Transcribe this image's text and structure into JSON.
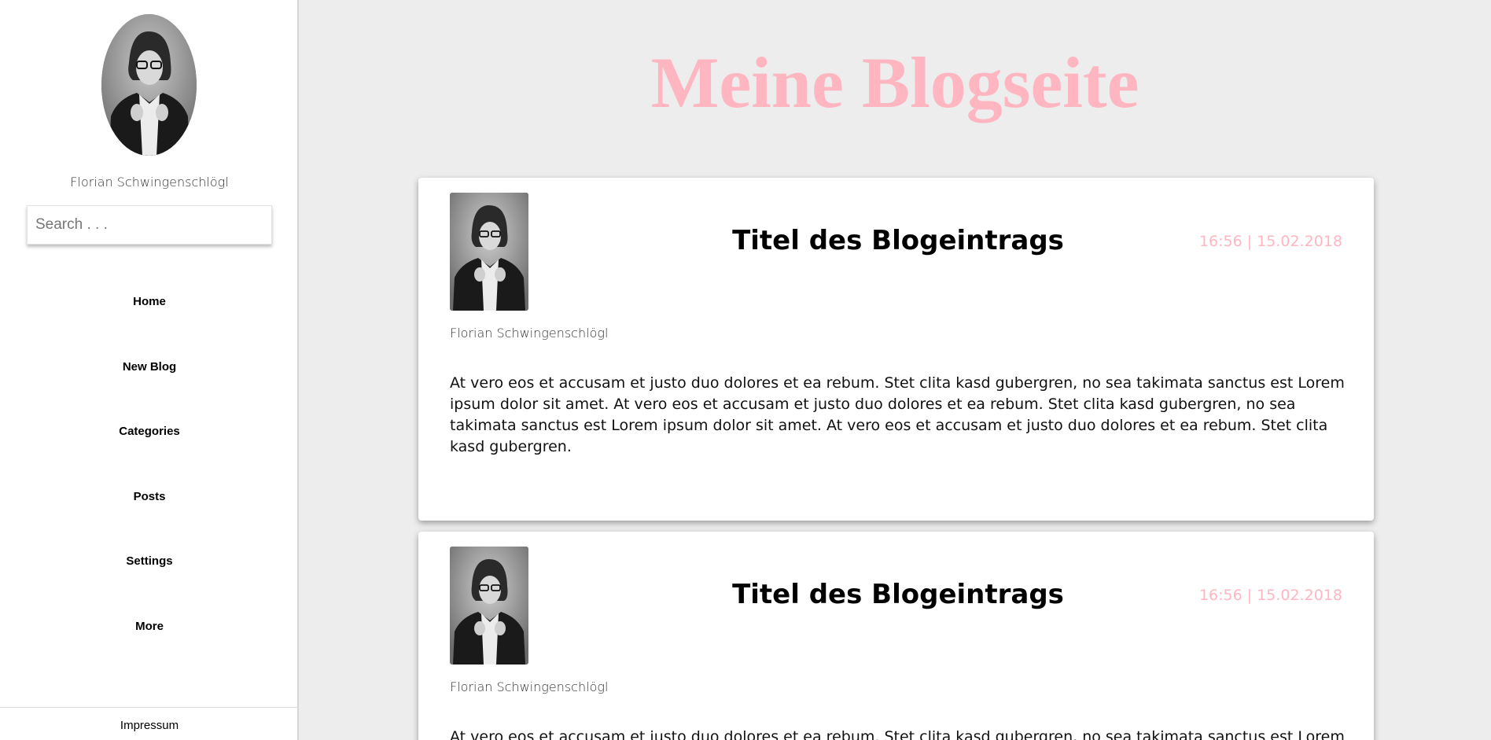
{
  "sidebar": {
    "profile_name": "Florian Schwingenschlögl",
    "search_placeholder": "Search . . .",
    "nav": [
      "Home",
      "New Blog",
      "Categories",
      "Posts",
      "Settings",
      "More"
    ],
    "footer_link": "Impressum"
  },
  "header": {
    "title": "Meine Blogseite"
  },
  "posts": [
    {
      "title": "Titel des Blogeintrags",
      "date": "16:56 | 15.02.2018",
      "author": "Florian Schwingenschlögl",
      "body": "At vero eos et accusam et justo duo dolores et ea rebum. Stet clita kasd gubergren, no sea takimata sanctus est Lorem ipsum dolor sit amet. At vero eos et accusam et justo duo dolores et ea rebum. Stet clita kasd gubergren, no sea takimata sanctus est Lorem ipsum dolor sit amet. At vero eos et accusam et justo duo dolores et ea rebum. Stet clita kasd gubergren."
    },
    {
      "title": "Titel des Blogeintrags",
      "date": "16:56 | 15.02.2018",
      "author": "Florian Schwingenschlögl",
      "body": "At vero eos et accusam et justo duo dolores et ea rebum. Stet clita kasd gubergren, no sea takimata sanctus est Lorem ipsum dolor sit amet."
    }
  ],
  "colors": {
    "accent_pink": "#ffb6c1",
    "page_background": "#ededed",
    "card_background": "#ffffff"
  }
}
